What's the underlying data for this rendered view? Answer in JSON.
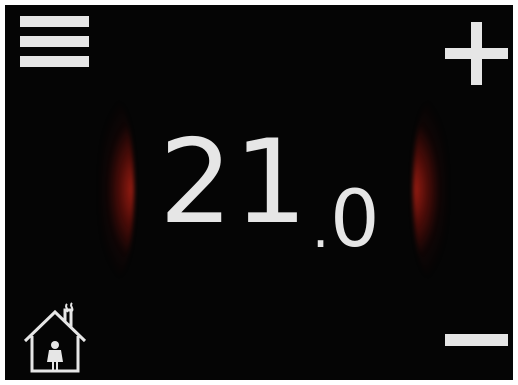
{
  "thermostat": {
    "temperature_integer": "21",
    "temperature_separator": ".",
    "temperature_decimal": "0",
    "icons": {
      "menu": "menu-icon",
      "increase": "plus-icon",
      "decrease": "minus-icon",
      "occupied_home": "home-person-icon"
    },
    "colors": {
      "background": "#050505",
      "foreground": "#e6e6e6",
      "heat_glow": "#a82014"
    }
  }
}
